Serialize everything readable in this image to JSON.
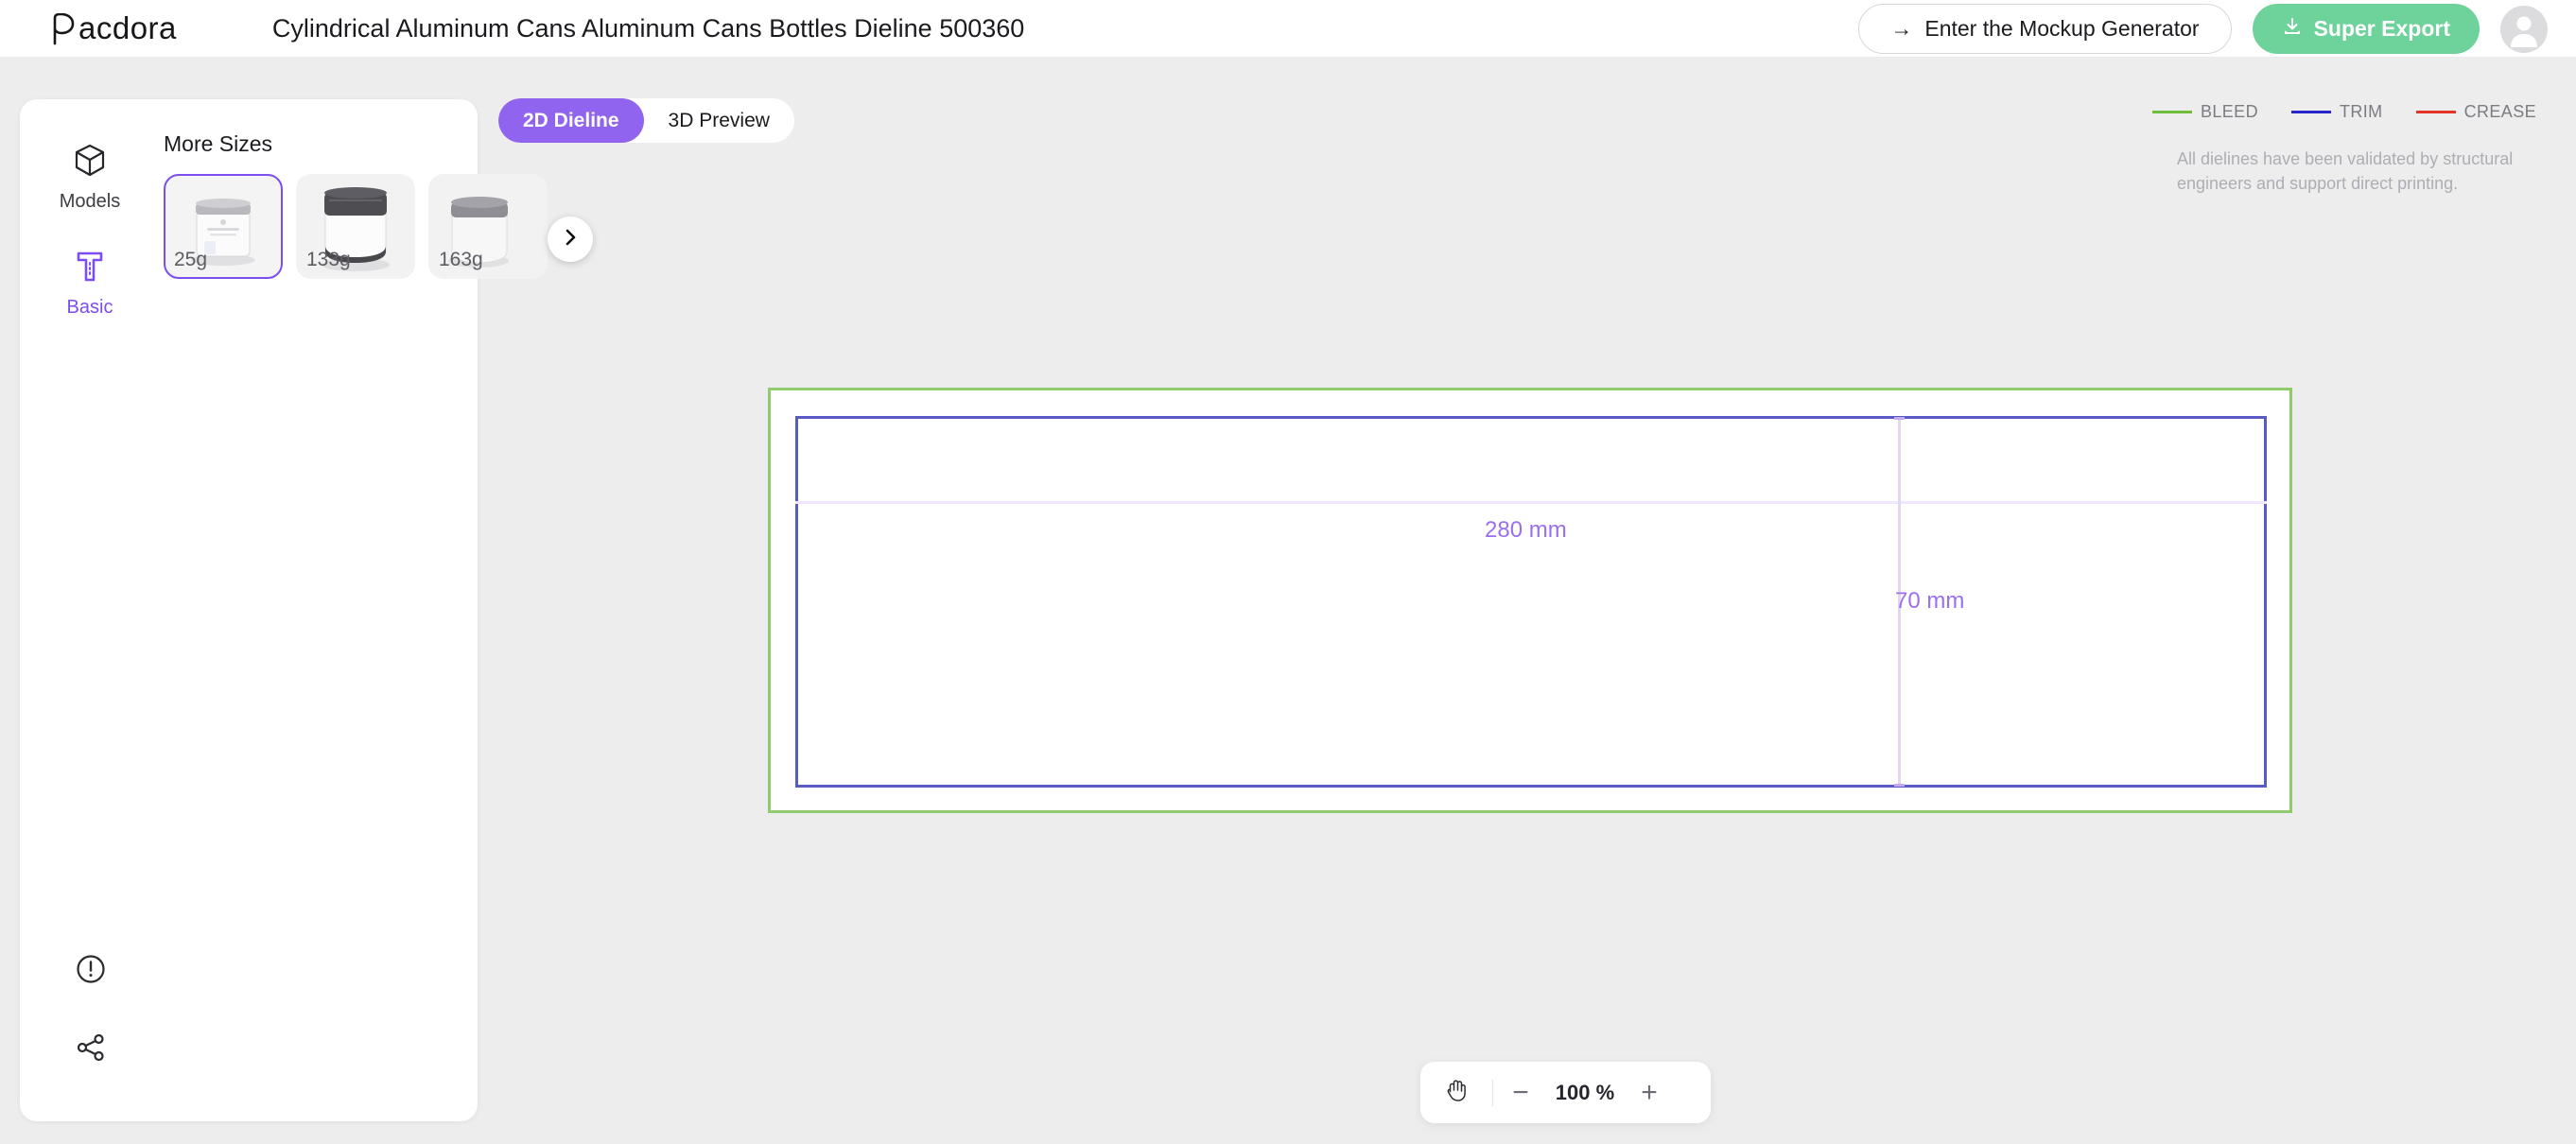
{
  "header": {
    "logo_text": "acdora",
    "logo_icon": "pacdora-p-logo-icon",
    "doc_title": "Cylindrical Aluminum Cans Aluminum Cans Bottles Dieline 500360",
    "mockup_button": "Enter the Mockup Generator",
    "mockup_arrow": "→",
    "export_button": "Super Export",
    "export_icon": "download-icon",
    "avatar_icon": "user-avatar-icon",
    "export_color": "#6ed39a"
  },
  "sidebar": {
    "rail": [
      {
        "label": "Models",
        "icon": "cube-3d-icon",
        "active": false
      },
      {
        "label": "Basic",
        "icon": "dieline-t-ruler-icon",
        "active": true
      }
    ],
    "sizes_title": "More Sizes",
    "thumbnails": [
      {
        "label": "25g",
        "selected": true
      },
      {
        "label": "133g",
        "selected": false
      },
      {
        "label": "163g",
        "selected": false
      }
    ],
    "next_arrow_icon": "chevron-right-icon",
    "bottom_icons": [
      {
        "icon": "info-alert-circle-icon"
      },
      {
        "icon": "share-icon"
      }
    ],
    "selected_color": "#7c4df0"
  },
  "tabs": [
    {
      "label": "2D Dieline",
      "active": true
    },
    {
      "label": "3D Preview",
      "active": false
    }
  ],
  "legend": {
    "items": [
      {
        "label": "BLEED",
        "color": "#6ebd3c"
      },
      {
        "label": "TRIM",
        "color": "#2727c9"
      },
      {
        "label": "CREASE",
        "color": "#e5332a"
      }
    ],
    "note": "All dielines have been validated by structural engineers and support direct printing."
  },
  "dieline": {
    "width_label": "280 mm",
    "height_label": "70 mm",
    "dimension_color": "#9b6ef0",
    "bleed_color": "#8fcc6e",
    "trim_color": "#5a5ac4"
  },
  "zoom_bar": {
    "pan_icon": "hand-pan-icon",
    "minus": "−",
    "level": "100 %",
    "plus": "+"
  }
}
